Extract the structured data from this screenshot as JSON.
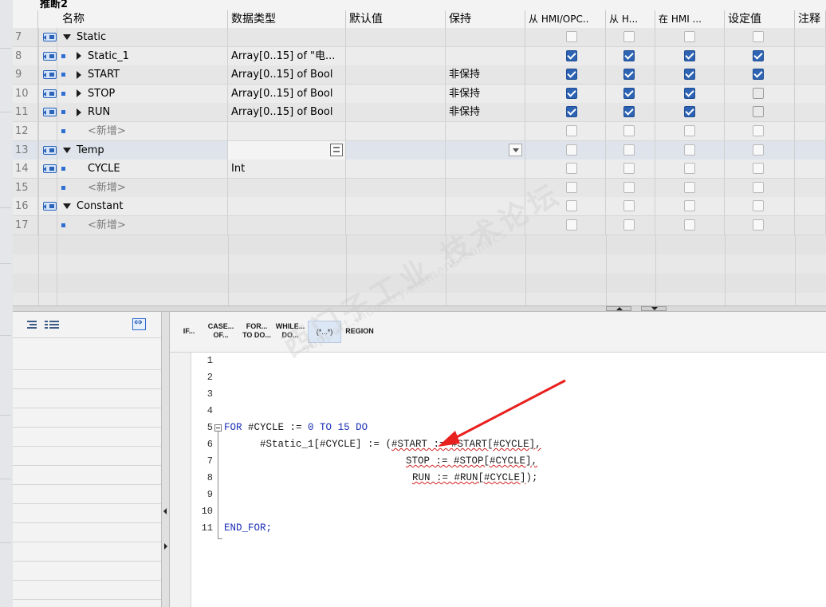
{
  "title": "推断2",
  "columns": {
    "name": "名称",
    "datatype": "数据类型",
    "default": "默认值",
    "retain": "保持",
    "hmi_opc": "从 HMI/OPC..",
    "from_h": "从 H...",
    "in_hmi": "在 HMI ...",
    "setpoint": "设定值",
    "comment": "注释"
  },
  "rows": [
    {
      "num": "7",
      "name": "Static",
      "type": "",
      "retain": "",
      "level": 0,
      "expand": "down",
      "icon": true,
      "bullet": false,
      "cb": [
        "off",
        "off",
        "off",
        "off"
      ]
    },
    {
      "num": "8",
      "name": "Static_1",
      "type": "Array[0..15] of \"电...",
      "retain": "",
      "level": 1,
      "expand": "right",
      "icon": true,
      "bullet": true,
      "cb": [
        "on",
        "on",
        "on",
        "on"
      ]
    },
    {
      "num": "9",
      "name": "START",
      "type": "Array[0..15] of Bool",
      "retain": "非保持",
      "level": 1,
      "expand": "right",
      "icon": true,
      "bullet": true,
      "cb": [
        "on",
        "on",
        "on",
        "on"
      ]
    },
    {
      "num": "10",
      "name": "STOP",
      "type": "Array[0..15] of Bool",
      "retain": "非保持",
      "level": 1,
      "expand": "right",
      "icon": true,
      "bullet": true,
      "cb": [
        "on",
        "on",
        "on",
        "mid"
      ]
    },
    {
      "num": "11",
      "name": "RUN",
      "type": "Array[0..15] of Bool",
      "retain": "非保持",
      "level": 1,
      "expand": "right",
      "icon": true,
      "bullet": true,
      "cb": [
        "on",
        "on",
        "on",
        "mid"
      ]
    },
    {
      "num": "12",
      "name": "<新增>",
      "type": "",
      "retain": "",
      "level": 1,
      "expand": "",
      "icon": false,
      "bullet": true,
      "cb": [
        "off",
        "off",
        "off",
        "off"
      ]
    },
    {
      "num": "13",
      "name": "Temp",
      "type": "",
      "retain": "",
      "level": 0,
      "expand": "down",
      "icon": true,
      "bullet": false,
      "cb": [
        "off",
        "off",
        "off",
        "off"
      ]
    },
    {
      "num": "14",
      "name": "CYCLE",
      "type": "Int",
      "retain": "",
      "level": 1,
      "expand": "",
      "icon": true,
      "bullet": true,
      "cb": [
        "off",
        "off",
        "off",
        "off"
      ]
    },
    {
      "num": "15",
      "name": "<新增>",
      "type": "",
      "retain": "",
      "level": 1,
      "expand": "",
      "icon": false,
      "bullet": true,
      "cb": [
        "off",
        "off",
        "off",
        "off"
      ]
    },
    {
      "num": "16",
      "name": "Constant",
      "type": "",
      "retain": "",
      "level": 0,
      "expand": "down",
      "icon": true,
      "bullet": false,
      "cb": [
        "off",
        "off",
        "off",
        "off"
      ]
    },
    {
      "num": "17",
      "name": "<新增>",
      "type": "",
      "retain": "",
      "level": 1,
      "expand": "",
      "icon": false,
      "bullet": true,
      "cb": [
        "off",
        "off",
        "off",
        "off"
      ]
    }
  ],
  "toolbar": {
    "if": "IF...",
    "case_1": "CASE...",
    "case_2": "OF...",
    "for_1": "FOR...",
    "for_2": "TO DO...",
    "while_1": "WHILE...",
    "while_2": "DO...",
    "comment": "(*...*)",
    "region": "REGION"
  },
  "code": {
    "line_numbers": [
      "1",
      "2",
      "3",
      "4",
      "5",
      "6",
      "7",
      "8",
      "9",
      "10",
      "11"
    ],
    "l5_kw1": "FOR",
    "l5_var": " #CYCLE := ",
    "l5_n0": "0",
    "l5_kw2": " TO ",
    "l5_n15": "15",
    "l5_kw3": " DO",
    "l6_a": "      #Static_1[#CYCLE] := (",
    "l6_b": "#START := #START[#CYCLE],",
    "l7": "STOP := #STOP[#CYCLE],",
    "l8": "RUN := #RUN[#CYCLE]",
    "l8_end": ");",
    "l11": "END_FOR;"
  },
  "watermark": {
    "line1": "西门子工业 技术论坛",
    "line2": "support.industry.siemens.com/cs"
  },
  "colors": {
    "checkbox_on": "#2d63b2",
    "keyword": "#1a2eb5",
    "arrow": "#e8201e"
  }
}
